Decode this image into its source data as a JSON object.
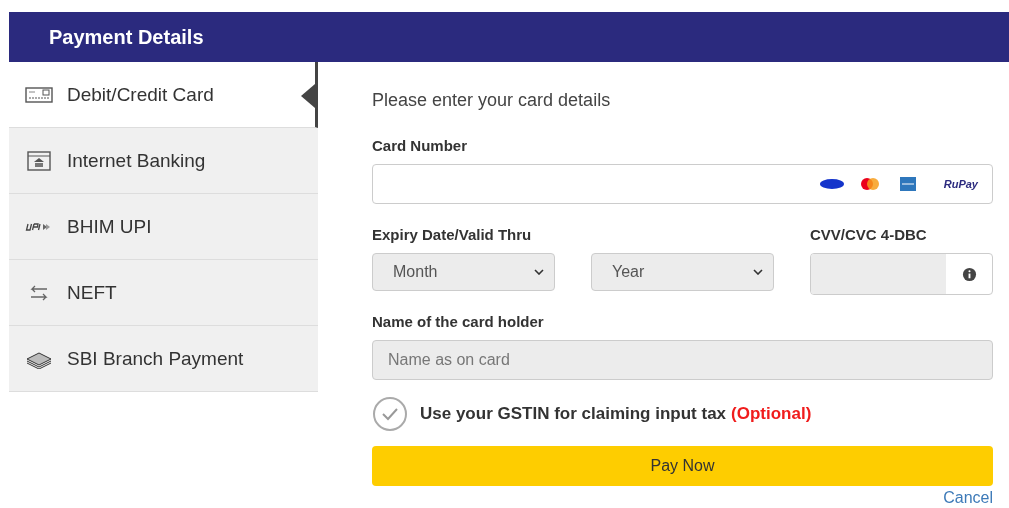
{
  "header": {
    "title": "Payment Details"
  },
  "sidebar": {
    "items": [
      {
        "label": "Debit/Credit Card",
        "kind": "card",
        "selected": true
      },
      {
        "label": "Internet Banking",
        "kind": "bank",
        "selected": false
      },
      {
        "label": "BHIM UPI",
        "kind": "upi",
        "selected": false
      },
      {
        "label": "NEFT",
        "kind": "neft",
        "selected": false
      },
      {
        "label": "SBI Branch Payment",
        "kind": "cash",
        "selected": false
      }
    ]
  },
  "form": {
    "heading": "Please enter your card details",
    "card_number": {
      "label": "Card Number",
      "rupay_logo": "RuPay"
    },
    "expiry": {
      "label": "Expiry Date/Valid Thru",
      "month_placeholder": "Month",
      "year_placeholder": "Year"
    },
    "cvv": {
      "label": "CVV/CVC 4-DBC"
    },
    "holder": {
      "label": "Name of the card holder",
      "placeholder": "Name as on card"
    },
    "gstin": {
      "label": "Use your GSTIN for claiming input tax",
      "note": "(Optional)",
      "checked": false
    },
    "pay_button": "Pay Now",
    "cancel_link": "Cancel"
  }
}
